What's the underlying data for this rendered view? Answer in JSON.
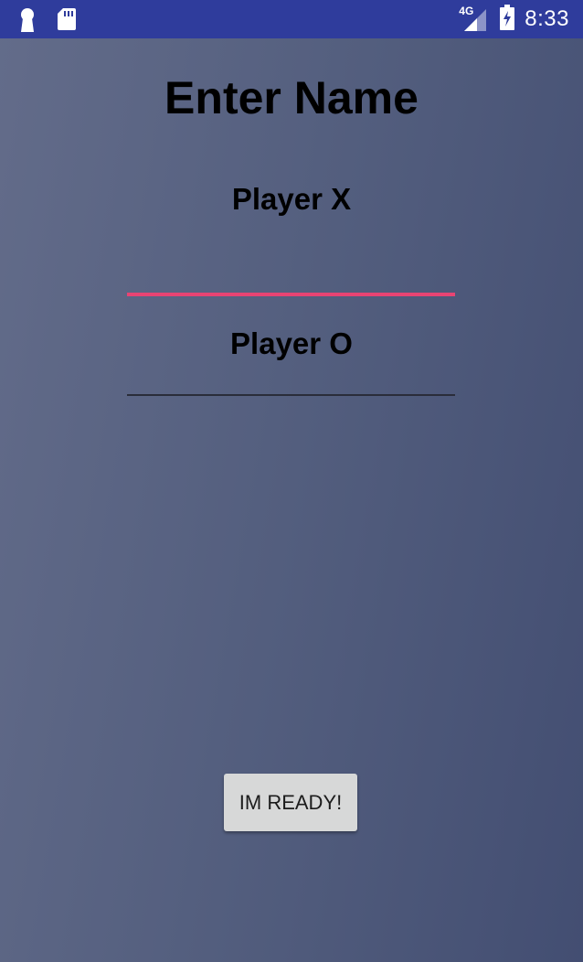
{
  "status_bar": {
    "time": "8:33",
    "network_type": "4G",
    "left_icons": [
      "keyhole-icon",
      "sd-card-icon"
    ],
    "right_icons": [
      "signal-icon",
      "battery-charging-icon"
    ]
  },
  "screen": {
    "title": "Enter Name",
    "player_x": {
      "label": "Player X",
      "value": "",
      "focused": true
    },
    "player_o": {
      "label": "Player O",
      "value": ""
    },
    "ready_button_label": "IM READY!"
  },
  "colors": {
    "status_bar": "#2f3c9c",
    "background_start": "#636c8a",
    "background_end": "#434e72",
    "input_focus_underline": "#e84473",
    "input_underline": "#2a2d3a",
    "button": "#d7d8d8"
  }
}
